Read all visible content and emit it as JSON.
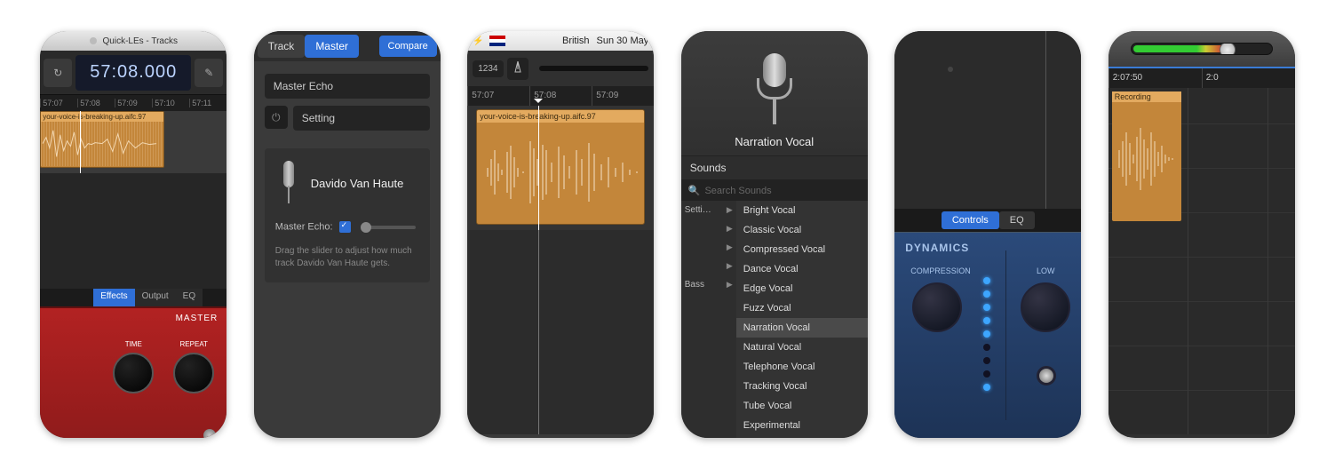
{
  "panel1": {
    "window_title": "Quick-LEs - Tracks",
    "time_display": "57:08.000",
    "ruler": [
      "57:07",
      "57:08",
      "57:09",
      "57:10",
      "57:11"
    ],
    "region_label": "your-voice-is-breaking-up.aifc.97",
    "tabs": {
      "effects": "Effects",
      "output": "Output",
      "eq": "EQ"
    },
    "amp_label": "MASTER",
    "knob_time": "TIME",
    "knob_repeat": "REPEAT"
  },
  "panel2": {
    "tab_track": "Track",
    "tab_master": "Master",
    "compare": "Compare",
    "field_name": "Master Echo",
    "field_setting": "Setting",
    "track_name": "Davido Van Haute",
    "slider_label": "Master Echo:",
    "help_text": "Drag the slider to adjust how much track Davido Van Haute gets."
  },
  "panel3": {
    "menubar_lang": "British",
    "menubar_date": "Sun 30 May",
    "counter_pill": "1234",
    "ruler": [
      "57:07",
      "57:08",
      "57:09"
    ],
    "region_label": "your-voice-is-breaking-up.aifc.97"
  },
  "panel4": {
    "preset_name": "Narration Vocal",
    "section_sounds": "Sounds",
    "search_placeholder": "Search Sounds",
    "left_col": [
      "Setti…",
      "",
      "",
      "",
      "Bass"
    ],
    "right_col": [
      "Bright Vocal",
      "Classic Vocal",
      "Compressed Vocal",
      "Dance Vocal",
      "Edge Vocal",
      "Fuzz Vocal",
      "Narration Vocal",
      "Natural Vocal",
      "Telephone Vocal",
      "Tracking Vocal",
      "Tube Vocal",
      "Experimental"
    ],
    "selected": "Narration Vocal"
  },
  "panel5": {
    "tab_controls": "Controls",
    "tab_eq": "EQ",
    "section": "DYNAMICS",
    "knob_compression": "COMPRESSION",
    "knob_low": "LOW"
  },
  "panel6": {
    "ruler": [
      "2:07:50",
      "2:0"
    ],
    "region_label": "Recording"
  }
}
